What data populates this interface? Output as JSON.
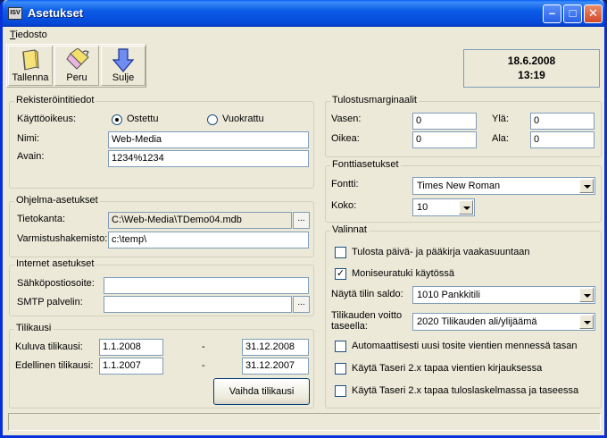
{
  "window": {
    "title": "Asetukset",
    "icon_text": "ISV",
    "minimize": "–",
    "maximize": "□",
    "close": "✕"
  },
  "menu": {
    "file": "Tiedosto"
  },
  "toolbar": {
    "save": "Tallenna",
    "undo": "Peru",
    "close": "Sulje"
  },
  "datetime": {
    "date": "18.6.2008",
    "time": "13:19"
  },
  "registration": {
    "title": "Rekisteröintitiedot",
    "license_label": "Käyttöoikeus:",
    "option_bought": "Ostettu",
    "option_rented": "Vuokrattu",
    "selected": "Ostettu",
    "name_label": "Nimi:",
    "name_value": "Web-Media",
    "key_label": "Avain:",
    "key_value": "1234%1234"
  },
  "program": {
    "title": "Ohjelma-asetukset",
    "db_label": "Tietokanta:",
    "db_value": "C:\\Web-Media\\TDemo04.mdb",
    "backup_label": "Varmistushakemisto:",
    "backup_value": "c:\\temp\\",
    "browse": "..."
  },
  "internet": {
    "title": "Internet asetukset",
    "email_label": "Sähköpostiosoite:",
    "email_value": "",
    "smtp_label": "SMTP palvelin:",
    "smtp_value": "",
    "browse": "..."
  },
  "fiscal": {
    "title": "Tilikausi",
    "current_label": "Kuluva tilikausi:",
    "current_start": "1.1.2008",
    "current_end": "31.12.2008",
    "previous_label": "Edellinen tilikausi:",
    "previous_start": "1.1.2007",
    "previous_end": "31.12.2007",
    "dash": "-",
    "change_button": "Vaihda tilikausi"
  },
  "margins": {
    "title": "Tulostusmarginaalit",
    "left_label": "Vasen:",
    "left_value": "0",
    "right_label": "Oikea:",
    "right_value": "0",
    "top_label": "Ylä:",
    "top_value": "0",
    "bottom_label": "Ala:",
    "bottom_value": "0"
  },
  "font": {
    "title": "Fonttiasetukset",
    "font_label": "Fontti:",
    "font_value": "Times New Roman",
    "size_label": "Koko:",
    "size_value": "10"
  },
  "options": {
    "title": "Valinnat",
    "landscape": "Tulosta päivä- ja pääkirja vaakasuuntaan",
    "landscape_checked": false,
    "multi": "Moniseuratuki käytössä",
    "multi_checked": true,
    "balance_label": "Näytä tilin saldo:",
    "balance_value": "1010 Pankkitili",
    "profit_label_1": "Tilikauden voitto",
    "profit_label_2": "taseella:",
    "profit_value": "2020 Tilikauden ali/ylijäämä",
    "auto_voucher": "Automaattisesti uusi tosite vientien mennessä tasan",
    "auto_voucher_checked": false,
    "taseri_entry": "Käytä Taseri 2.x tapaa vientien kirjauksessa",
    "taseri_entry_checked": false,
    "taseri_income": "Käytä Taseri 2.x tapaa tuloslaskelmassa ja taseessa",
    "taseri_income_checked": false
  },
  "status": {
    "text": ""
  }
}
